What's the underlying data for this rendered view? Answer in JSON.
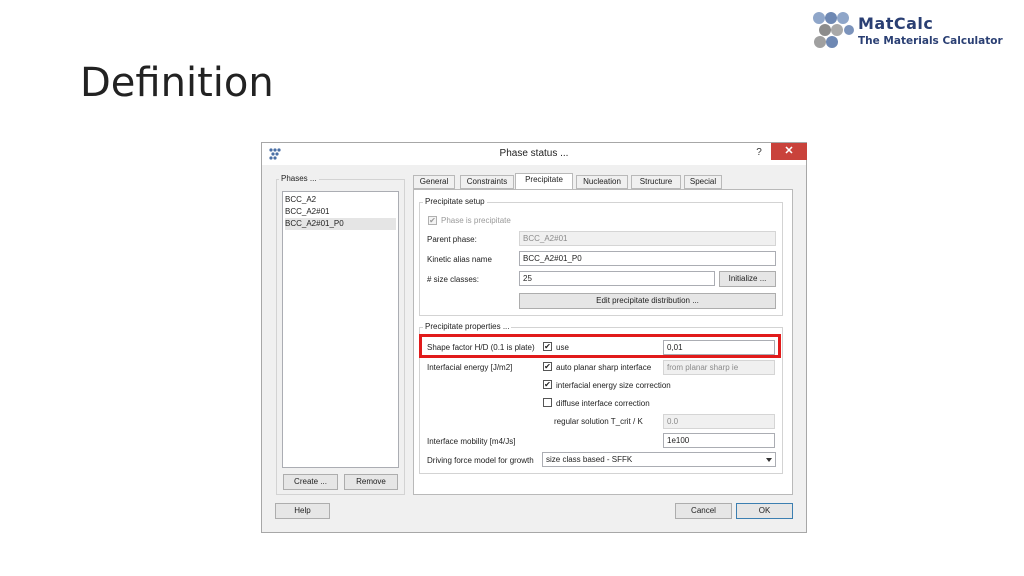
{
  "slide": {
    "title": "Definition"
  },
  "logo": {
    "line1": "MatCalc",
    "line2": "The Materials Calculator"
  },
  "dialog": {
    "title": "Phase status ...",
    "help_label": "?",
    "close_label": "✕",
    "phases": {
      "group_title": "Phases ...",
      "items": [
        "BCC_A2",
        "BCC_A2#01",
        "BCC_A2#01_P0"
      ],
      "selected_index": 2,
      "create_label": "Create ...",
      "remove_label": "Remove"
    },
    "tabs": [
      "General",
      "Constraints",
      "Precipitate",
      "Nucleation",
      "Structure",
      "Special"
    ],
    "active_tab": "Precipitate",
    "precipitate_setup": {
      "group_title": "Precipitate setup",
      "is_precipitate_label": "Phase is precipitate",
      "is_precipitate_checked": true,
      "parent_phase_label": "Parent phase:",
      "parent_phase_value": "BCC_A2#01",
      "kinetic_alias_label": "Kinetic alias name",
      "kinetic_alias_value": "BCC_A2#01_P0",
      "size_classes_label": "# size classes:",
      "size_classes_value": "25",
      "initialize_label": "Initialize ...",
      "edit_distribution_label": "Edit precipitate distribution ..."
    },
    "precipitate_properties": {
      "group_title": "Precipitate properties ...",
      "shape_factor_label": "Shape factor H/D (0.1 is plate)",
      "use_label": "use",
      "use_checked": true,
      "shape_factor_value": "0,01",
      "interfacial_energy_label": "Interfacial energy [J/m2]",
      "auto_planar_label": "auto planar sharp interface",
      "auto_planar_checked": true,
      "auto_planar_value": "from planar sharp ie",
      "size_correction_label": "interfacial energy size correction",
      "size_correction_checked": true,
      "diffuse_label": "diffuse interface correction",
      "diffuse_checked": false,
      "regular_solution_label": "regular solution T_crit / K",
      "regular_solution_value": "0.0",
      "mobility_label": "Interface mobility [m4/Js]",
      "mobility_value": "1e100",
      "driving_force_label": "Driving force model for growth",
      "driving_force_value": "size class based - SFFK"
    },
    "help_button_label": "Help",
    "cancel_label": "Cancel",
    "ok_label": "OK",
    "highlight_color": "#e11b1b"
  }
}
